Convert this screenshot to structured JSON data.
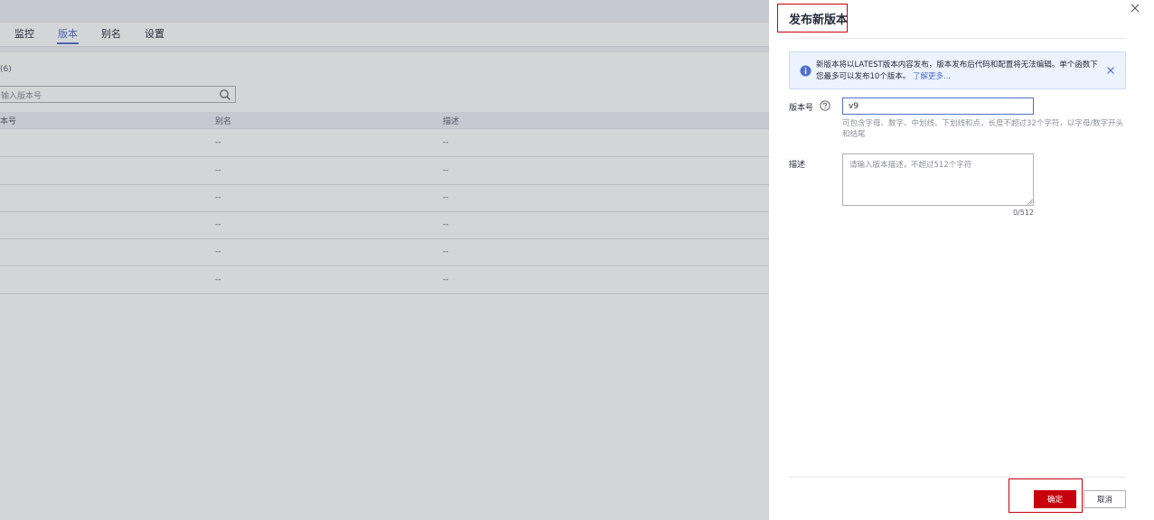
{
  "background_page": {
    "tabs": [
      {
        "label": "监控"
      },
      {
        "label": "版本",
        "active": true
      },
      {
        "label": "别名"
      },
      {
        "label": "设置"
      }
    ],
    "count_text": "(6)",
    "search_placeholder": "输入版本号",
    "table": {
      "headers": [
        "本号",
        "别名",
        "描述"
      ],
      "rows": [
        [
          "",
          "--",
          "--"
        ],
        [
          "",
          "--",
          "--"
        ],
        [
          "",
          "--",
          "--"
        ],
        [
          "",
          "--",
          "--"
        ],
        [
          "",
          "--",
          "--"
        ],
        [
          "",
          "--",
          "--"
        ]
      ]
    }
  },
  "drawer": {
    "title": "发布新版本",
    "notice": {
      "text": "新版本将以LATEST版本内容发布，版本发布后代码和配置将无法编辑。单个函数下您最多可以发布10个版本。",
      "link": "了解更多..."
    },
    "version_field": {
      "label": "版本号",
      "value": "v9",
      "hint": "可包含字母、数字、中划线、下划线和点，长度不超过32个字符，以字母/数字开头和结尾"
    },
    "description_field": {
      "label": "描述",
      "placeholder": "请输入版本描述，不超过512个字符",
      "counter": "0/512"
    },
    "buttons": {
      "confirm": "确定",
      "cancel": "取消"
    }
  },
  "colors": {
    "primary": "#c7000b",
    "accent_blue": "#526ecc",
    "notice_bg": "#eaf3ff"
  },
  "icons": {
    "close": "close-icon",
    "info": "info-icon",
    "help": "help-circle-icon",
    "search": "search-icon"
  }
}
